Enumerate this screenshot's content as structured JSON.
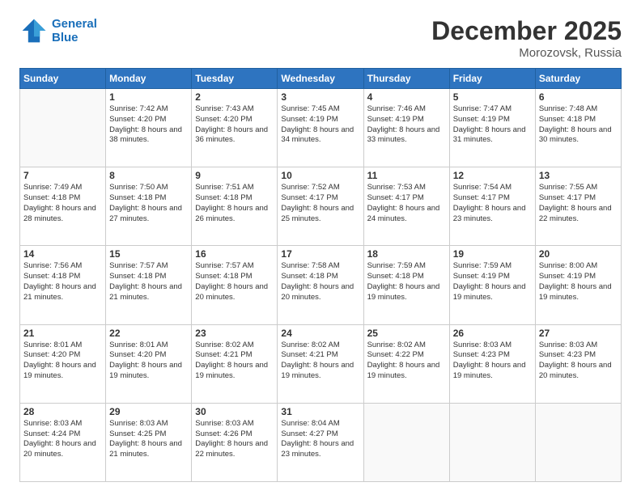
{
  "header": {
    "logo_line1": "General",
    "logo_line2": "Blue",
    "month": "December 2025",
    "location": "Morozovsk, Russia"
  },
  "weekdays": [
    "Sunday",
    "Monday",
    "Tuesday",
    "Wednesday",
    "Thursday",
    "Friday",
    "Saturday"
  ],
  "weeks": [
    [
      {
        "day": "",
        "info": ""
      },
      {
        "day": "1",
        "info": "Sunrise: 7:42 AM\nSunset: 4:20 PM\nDaylight: 8 hours\nand 38 minutes."
      },
      {
        "day": "2",
        "info": "Sunrise: 7:43 AM\nSunset: 4:20 PM\nDaylight: 8 hours\nand 36 minutes."
      },
      {
        "day": "3",
        "info": "Sunrise: 7:45 AM\nSunset: 4:19 PM\nDaylight: 8 hours\nand 34 minutes."
      },
      {
        "day": "4",
        "info": "Sunrise: 7:46 AM\nSunset: 4:19 PM\nDaylight: 8 hours\nand 33 minutes."
      },
      {
        "day": "5",
        "info": "Sunrise: 7:47 AM\nSunset: 4:19 PM\nDaylight: 8 hours\nand 31 minutes."
      },
      {
        "day": "6",
        "info": "Sunrise: 7:48 AM\nSunset: 4:18 PM\nDaylight: 8 hours\nand 30 minutes."
      }
    ],
    [
      {
        "day": "7",
        "info": "Sunrise: 7:49 AM\nSunset: 4:18 PM\nDaylight: 8 hours\nand 28 minutes."
      },
      {
        "day": "8",
        "info": "Sunrise: 7:50 AM\nSunset: 4:18 PM\nDaylight: 8 hours\nand 27 minutes."
      },
      {
        "day": "9",
        "info": "Sunrise: 7:51 AM\nSunset: 4:18 PM\nDaylight: 8 hours\nand 26 minutes."
      },
      {
        "day": "10",
        "info": "Sunrise: 7:52 AM\nSunset: 4:17 PM\nDaylight: 8 hours\nand 25 minutes."
      },
      {
        "day": "11",
        "info": "Sunrise: 7:53 AM\nSunset: 4:17 PM\nDaylight: 8 hours\nand 24 minutes."
      },
      {
        "day": "12",
        "info": "Sunrise: 7:54 AM\nSunset: 4:17 PM\nDaylight: 8 hours\nand 23 minutes."
      },
      {
        "day": "13",
        "info": "Sunrise: 7:55 AM\nSunset: 4:17 PM\nDaylight: 8 hours\nand 22 minutes."
      }
    ],
    [
      {
        "day": "14",
        "info": "Sunrise: 7:56 AM\nSunset: 4:18 PM\nDaylight: 8 hours\nand 21 minutes."
      },
      {
        "day": "15",
        "info": "Sunrise: 7:57 AM\nSunset: 4:18 PM\nDaylight: 8 hours\nand 21 minutes."
      },
      {
        "day": "16",
        "info": "Sunrise: 7:57 AM\nSunset: 4:18 PM\nDaylight: 8 hours\nand 20 minutes."
      },
      {
        "day": "17",
        "info": "Sunrise: 7:58 AM\nSunset: 4:18 PM\nDaylight: 8 hours\nand 20 minutes."
      },
      {
        "day": "18",
        "info": "Sunrise: 7:59 AM\nSunset: 4:18 PM\nDaylight: 8 hours\nand 19 minutes."
      },
      {
        "day": "19",
        "info": "Sunrise: 7:59 AM\nSunset: 4:19 PM\nDaylight: 8 hours\nand 19 minutes."
      },
      {
        "day": "20",
        "info": "Sunrise: 8:00 AM\nSunset: 4:19 PM\nDaylight: 8 hours\nand 19 minutes."
      }
    ],
    [
      {
        "day": "21",
        "info": "Sunrise: 8:01 AM\nSunset: 4:20 PM\nDaylight: 8 hours\nand 19 minutes."
      },
      {
        "day": "22",
        "info": "Sunrise: 8:01 AM\nSunset: 4:20 PM\nDaylight: 8 hours\nand 19 minutes."
      },
      {
        "day": "23",
        "info": "Sunrise: 8:02 AM\nSunset: 4:21 PM\nDaylight: 8 hours\nand 19 minutes."
      },
      {
        "day": "24",
        "info": "Sunrise: 8:02 AM\nSunset: 4:21 PM\nDaylight: 8 hours\nand 19 minutes."
      },
      {
        "day": "25",
        "info": "Sunrise: 8:02 AM\nSunset: 4:22 PM\nDaylight: 8 hours\nand 19 minutes."
      },
      {
        "day": "26",
        "info": "Sunrise: 8:03 AM\nSunset: 4:23 PM\nDaylight: 8 hours\nand 19 minutes."
      },
      {
        "day": "27",
        "info": "Sunrise: 8:03 AM\nSunset: 4:23 PM\nDaylight: 8 hours\nand 20 minutes."
      }
    ],
    [
      {
        "day": "28",
        "info": "Sunrise: 8:03 AM\nSunset: 4:24 PM\nDaylight: 8 hours\nand 20 minutes."
      },
      {
        "day": "29",
        "info": "Sunrise: 8:03 AM\nSunset: 4:25 PM\nDaylight: 8 hours\nand 21 minutes."
      },
      {
        "day": "30",
        "info": "Sunrise: 8:03 AM\nSunset: 4:26 PM\nDaylight: 8 hours\nand 22 minutes."
      },
      {
        "day": "31",
        "info": "Sunrise: 8:04 AM\nSunset: 4:27 PM\nDaylight: 8 hours\nand 23 minutes."
      },
      {
        "day": "",
        "info": ""
      },
      {
        "day": "",
        "info": ""
      },
      {
        "day": "",
        "info": ""
      }
    ]
  ]
}
